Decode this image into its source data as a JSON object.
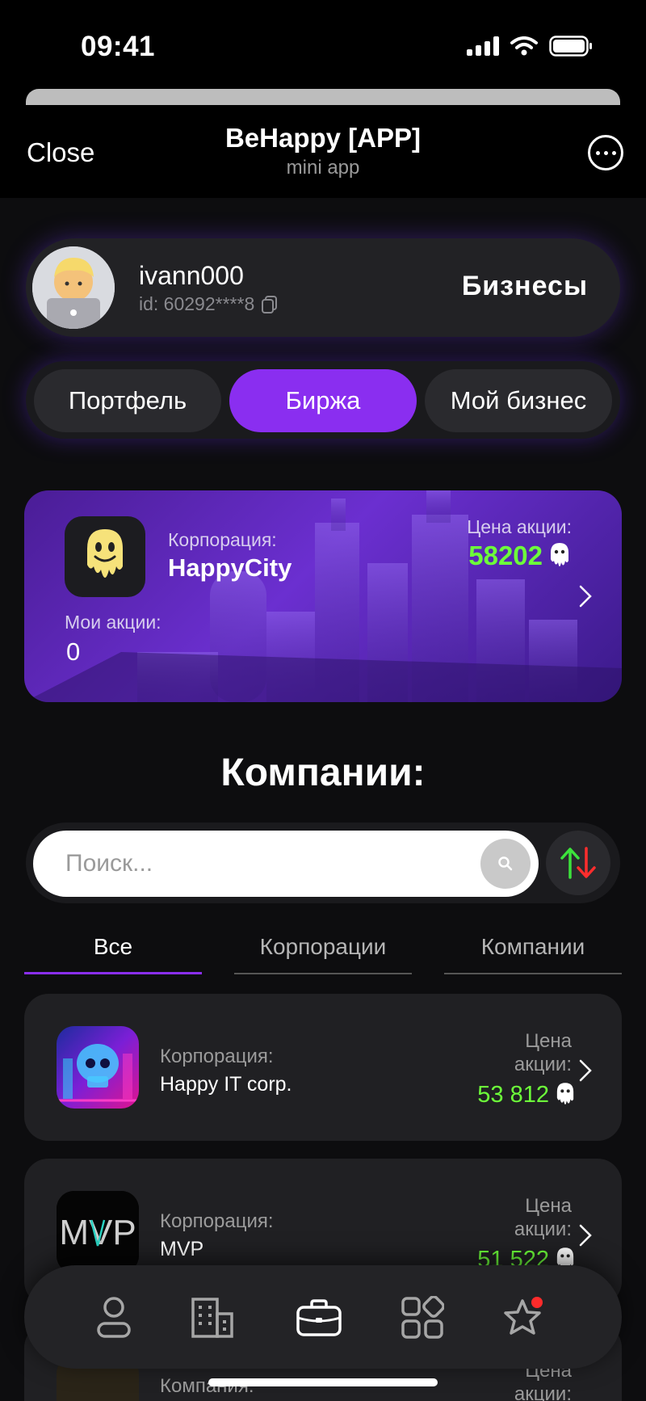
{
  "status_bar": {
    "time": "09:41"
  },
  "header": {
    "close_label": "Close",
    "title": "BeHappy [APP]",
    "subtitle": "mini app"
  },
  "profile": {
    "username": "ivann000",
    "id_text": "id: 60292****8",
    "businesses_label": "Бизнесы"
  },
  "segments": [
    {
      "label": "Портфель",
      "active": false
    },
    {
      "label": "Биржа",
      "active": true
    },
    {
      "label": "Мой бизнес",
      "active": false
    }
  ],
  "featured": {
    "type_label": "Корпорация:",
    "name": "HappyCity",
    "price_label": "Цена акции:",
    "price": "58202",
    "my_shares_label": "Мои акции:",
    "my_shares": "0"
  },
  "companies_title": "Компании:",
  "search": {
    "placeholder": "Поиск..."
  },
  "filter_tabs": [
    {
      "label": "Все",
      "active": true
    },
    {
      "label": "Корпорации",
      "active": false
    },
    {
      "label": "Компании",
      "active": false
    }
  ],
  "companies": [
    {
      "type_label": "Корпорация:",
      "name": "Happy IT corp.",
      "price_label_1": "Цена",
      "price_label_2": "акции:",
      "price": "53 812",
      "logo": "neon-skull-city-logo"
    },
    {
      "type_label": "Корпорация:",
      "name": "MVP",
      "price_label_1": "Цена",
      "price_label_2": "акции:",
      "price": "51 522",
      "logo_text": "MVP"
    },
    {
      "type_label": "Компания:",
      "name": "",
      "price_label_1": "Цена",
      "price_label_2": "акции:",
      "price": ""
    }
  ],
  "bottom_nav": [
    {
      "icon": "profile-icon"
    },
    {
      "icon": "buildings-icon"
    },
    {
      "icon": "briefcase-icon",
      "active": true
    },
    {
      "icon": "apps-grid-icon"
    },
    {
      "icon": "star-icon",
      "has_badge": true
    }
  ],
  "colors": {
    "accent": "#8a2ef0",
    "price_green": "#6dff3a",
    "background": "#0d0d0f",
    "card": "#202023"
  }
}
